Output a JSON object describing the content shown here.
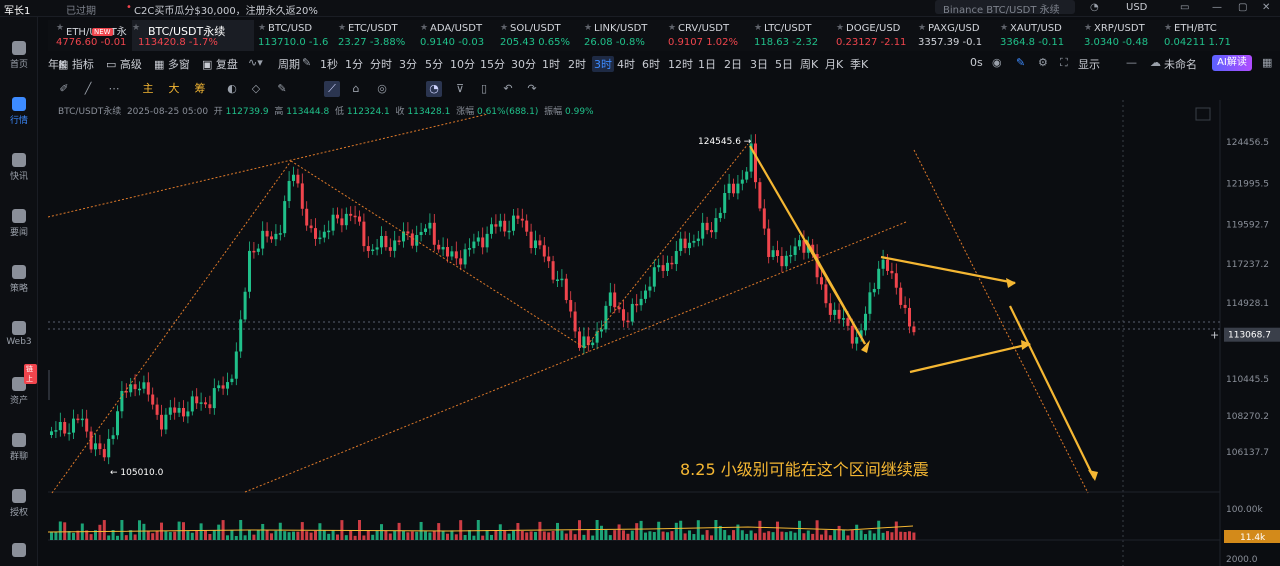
{
  "topbar": {
    "user": "军长1",
    "expired": "已过期",
    "promo": "C2C买币瓜分$30,000，注册永久返20%",
    "search_placeholder": "Binance BTC/USDT 永续",
    "currency": "USD"
  },
  "sidebar": {
    "items": [
      {
        "label": "首页",
        "active": false
      },
      {
        "label": "行情",
        "active": true
      },
      {
        "label": "快讯",
        "active": false
      },
      {
        "label": "要闻",
        "active": false
      },
      {
        "label": "策略",
        "active": false
      },
      {
        "label": "Web3",
        "active": false
      },
      {
        "label": "资产",
        "active": false
      },
      {
        "label": "群聊",
        "active": false
      },
      {
        "label": "授权",
        "active": false
      }
    ],
    "asset_badge": "链上"
  },
  "tickers": [
    {
      "symbol": "ETH/USDT永",
      "price": "4776.60",
      "change": "-0.01",
      "dir": "dn"
    },
    {
      "symbol": "BTC/USDT永续",
      "price": "113420.8",
      "change": "-1.7%",
      "dir": "dn",
      "active": true
    },
    {
      "symbol": "BTC/USD",
      "price": "113710.0",
      "change": "-1.6",
      "dir": "up"
    },
    {
      "symbol": "ETC/USDT",
      "price": "23.27",
      "change": "-3.88%",
      "dir": "up"
    },
    {
      "symbol": "ADA/USDT",
      "price": "0.9140",
      "change": "-0.03",
      "dir": "up"
    },
    {
      "symbol": "SOL/USDT",
      "price": "205.43",
      "change": "0.65%",
      "dir": "up"
    },
    {
      "symbol": "LINK/USDT",
      "price": "26.08",
      "change": "-0.8%",
      "dir": "up"
    },
    {
      "symbol": "CRV/USDT",
      "price": "0.9107",
      "change": "1.02%",
      "dir": "dn"
    },
    {
      "symbol": "LTC/USDT",
      "price": "118.63",
      "change": "-2.32",
      "dir": "up"
    },
    {
      "symbol": "DOGE/USD",
      "price": "0.23127",
      "change": "-2.11",
      "dir": "dn"
    },
    {
      "symbol": "PAXG/USD",
      "price": "3357.39",
      "change": "-0.1",
      "dir": "neutral"
    },
    {
      "symbol": "XAUT/USD",
      "price": "3364.8",
      "change": "-0.11",
      "dir": "up"
    },
    {
      "symbol": "XRP/USDT",
      "price": "3.0340",
      "change": "-0.48",
      "dir": "up"
    },
    {
      "symbol": "ETH/BTC",
      "price": "0.04211",
      "change": "1.71",
      "dir": "up"
    }
  ],
  "new_badge": "NEW",
  "toolbar1": {
    "indicators": "指标",
    "advanced": "高级",
    "multi": "多窗",
    "replay": "复盘",
    "period": "周期",
    "intervals": [
      "1秒",
      "1分",
      "分时",
      "3分",
      "5分",
      "10分",
      "15分",
      "30分",
      "1时",
      "2时",
      "3时",
      "4时",
      "6时",
      "12时",
      "1日",
      "2日",
      "3日",
      "5日",
      "周K",
      "月K",
      "季K",
      "年K"
    ],
    "selected_interval": "3时",
    "countdown": "0s",
    "display": "显示",
    "unnamed": "未命名",
    "ai": "AI解读"
  },
  "toolbar2": {
    "main": "主",
    "big": "大",
    "chip": "筹"
  },
  "ohlc": {
    "pair": "BTC/USDT永续",
    "time": "2025-08-25 05:00",
    "open_label": "开",
    "open": "112739.9",
    "high_label": "高",
    "high": "113444.8",
    "low_label": "低",
    "low": "112324.1",
    "close_label": "收",
    "close": "113428.1",
    "chg_label": "涨幅",
    "chg": "0.61%(688.1)",
    "amp_label": "振幅",
    "amp": "0.99%"
  },
  "chart_data": {
    "type": "candlestick",
    "y_ticks": [
      "124456.5",
      "121995.5",
      "119592.7",
      "117237.2",
      "114928.1",
      "110445.5",
      "108270.2",
      "106137.7"
    ],
    "current_price": "113068.7",
    "high_marker": "124545.6",
    "low_marker": "105010.0",
    "volume_ticks": [
      "100.00k",
      "2000.0"
    ],
    "volume_current": "11.4k",
    "annotation": "8.25 小级别可能在这个区间继续震",
    "colors": {
      "up": "#20c08a",
      "down": "#f0454d",
      "trendline": "#e07a2a",
      "arrow": "#f5b733"
    }
  }
}
